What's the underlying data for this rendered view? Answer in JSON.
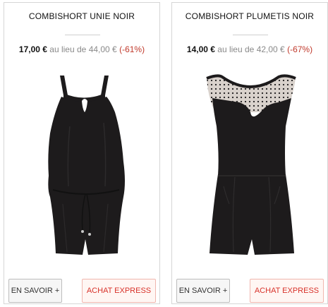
{
  "products": [
    {
      "name": "COMBISHORT UNIE NOIR",
      "price": "17,00 €",
      "regular_label": "au lieu de",
      "regular_price": "44,00 €",
      "discount": "(-61%)",
      "more_button": "EN SAVOIR +",
      "express_button": "ACHAT EXPRESS"
    },
    {
      "name": "COMBISHORT PLUMETIS NOIR",
      "price": "14,00 €",
      "regular_label": "au lieu de",
      "regular_price": "42,00 €",
      "discount": "(-67%)",
      "more_button": "EN SAVOIR +",
      "express_button": "ACHAT EXPRESS"
    }
  ],
  "colors": {
    "card_border": "#d6d6d6",
    "discount": "#c0392b",
    "express_text": "#d8322a",
    "garment": "#1d1b1c"
  }
}
